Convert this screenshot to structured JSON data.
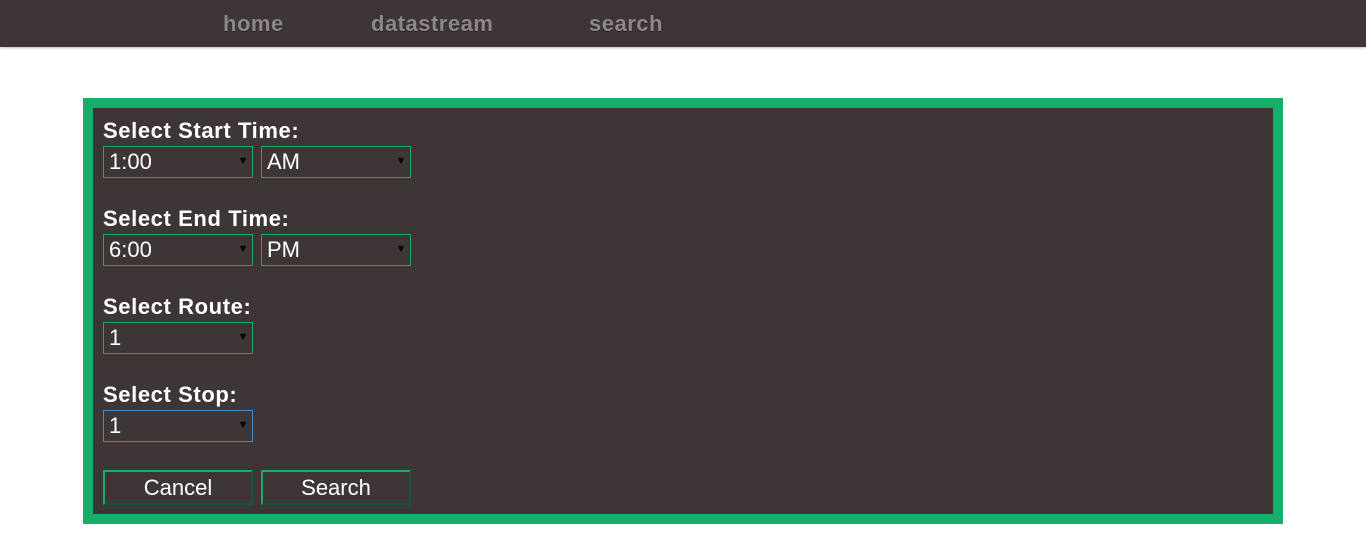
{
  "nav": {
    "items": [
      {
        "label": "home"
      },
      {
        "label": "datastream"
      },
      {
        "label": "search"
      }
    ]
  },
  "form": {
    "start_time": {
      "label": "Select Start Time:",
      "time_value": "1:00",
      "period_value": "AM"
    },
    "end_time": {
      "label": "Select End Time:",
      "time_value": "6:00",
      "period_value": "PM"
    },
    "route": {
      "label": "Select Route:",
      "value": "1"
    },
    "stop": {
      "label": "Select Stop:",
      "value": "1"
    },
    "buttons": {
      "cancel_label": "Cancel",
      "search_label": "Search"
    }
  },
  "colors": {
    "accent": "#17ad6b",
    "background_dark": "#3e3537",
    "focus": "#3b8ed4",
    "nav_text": "#8c8888"
  }
}
